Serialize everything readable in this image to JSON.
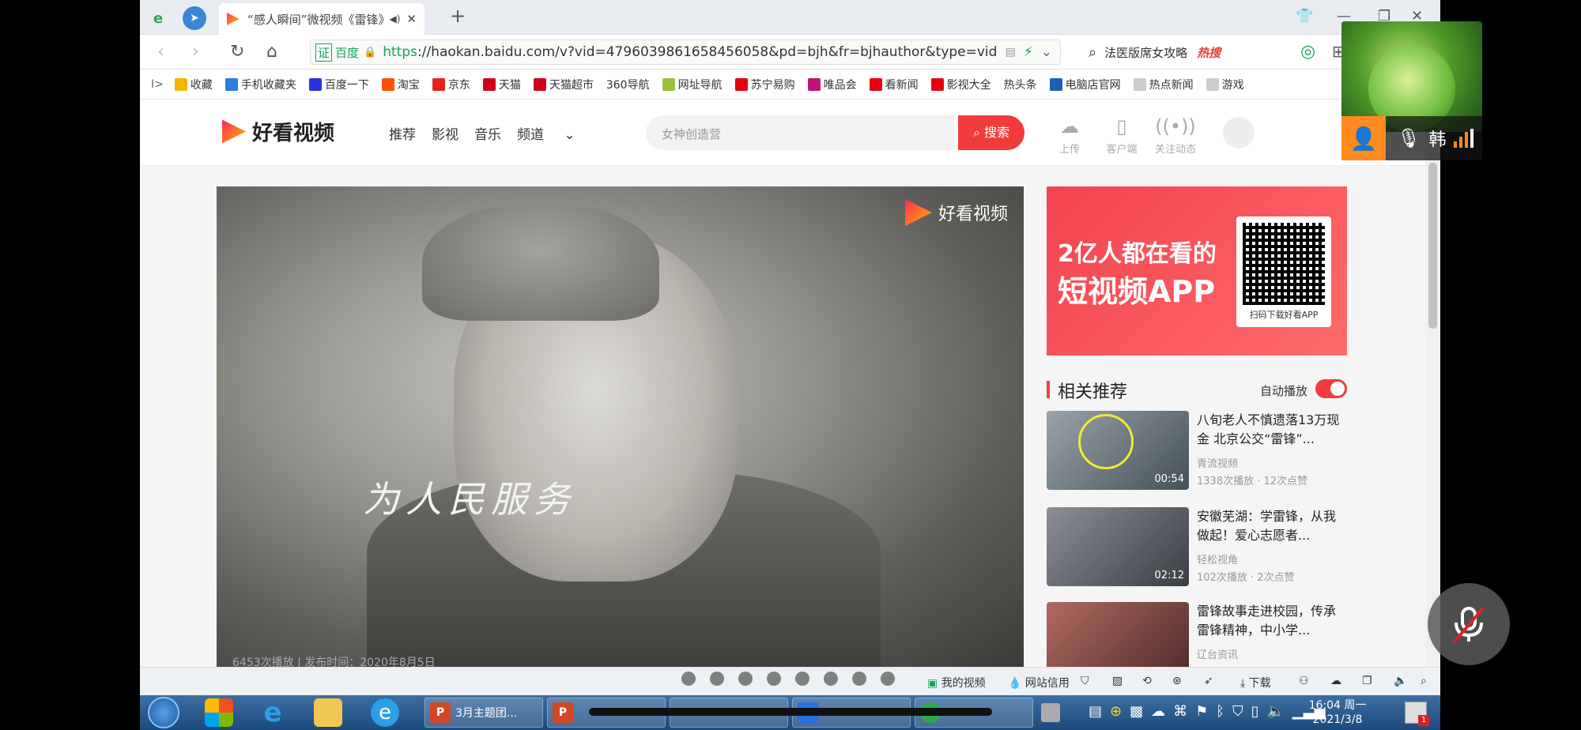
{
  "browser": {
    "tab_title": "“感人瞬间”微视频《雷锋》",
    "url_prefix": "https",
    "url_rest": "://haokan.baidu.com/v?vid=4796039861658456058&pd=bjh&fr=bjhauthor&type=video",
    "cert_label": "证",
    "site_badge": "百度",
    "search_text": "法医版席女攻略",
    "hot_label": "热搜"
  },
  "bookmarks": [
    {
      "label": "收藏",
      "color": "#f4b400",
      "icon": "star-icon"
    },
    {
      "label": "手机收藏夹",
      "color": "#2a7de1",
      "icon": "phone-icon"
    },
    {
      "label": "百度一下",
      "color": "#2932e1",
      "icon": "paw-icon"
    },
    {
      "label": "淘宝",
      "color": "#ff5000",
      "icon": "taobao-icon"
    },
    {
      "label": "京东",
      "color": "#e1251b",
      "icon": "jd-icon"
    },
    {
      "label": "天猫",
      "color": "#d0021b",
      "icon": "tmall-icon"
    },
    {
      "label": "天猫超市",
      "color": "#d0021b",
      "icon": "tmall-icon"
    },
    {
      "label": "360导航",
      "color": "#ffffff",
      "icon": ""
    },
    {
      "label": "网址导航",
      "color": "#9bc23c",
      "icon": "nav-icon"
    },
    {
      "label": "苏宁易购",
      "color": "#e60012",
      "icon": "suning-icon"
    },
    {
      "label": "唯品会",
      "color": "#c2127a",
      "icon": "vip-icon"
    },
    {
      "label": "看新闻",
      "color": "#e60012",
      "icon": "news-icon"
    },
    {
      "label": "影视大全",
      "color": "#e60012",
      "icon": "video-icon"
    },
    {
      "label": "热头条",
      "color": "#ffffff",
      "icon": ""
    },
    {
      "label": "电脑店官网",
      "color": "#1d5fb4",
      "icon": "pc-icon"
    },
    {
      "label": "热点新闻",
      "color": "#cccccc",
      "icon": "doc-icon"
    },
    {
      "label": "游戏",
      "color": "#cccccc",
      "icon": "doc-icon"
    }
  ],
  "site": {
    "logo": "好看视频",
    "nav": [
      "推荐",
      "影视",
      "音乐",
      "频道"
    ],
    "search_placeholder": "女神创造营",
    "search_button": "搜索",
    "header_icons": [
      {
        "label": "上传",
        "icon": "upload-icon"
      },
      {
        "label": "客户端",
        "icon": "client-icon"
      },
      {
        "label": "关注动态",
        "icon": "feed-icon"
      }
    ]
  },
  "video": {
    "watermark": "好看视频",
    "calligraphy": "为人民服务",
    "stats": "6453次播放 | 发布时间：2020年8月5日"
  },
  "ad": {
    "line1": "2亿人都在看的",
    "line2": "短视频APP",
    "qr_label": "扫码下载好看APP"
  },
  "recommend": {
    "title": "相关推荐",
    "autoplay_label": "自动播放",
    "autoplay_on": true,
    "items": [
      {
        "title": "八旬老人不慎遗落13万现金 北京公交“雷锋”...",
        "source": "青流视频",
        "meta": "1338次播放 · 12次点赞",
        "duration": "00:54"
      },
      {
        "title": "安徽芜湖：学雷锋，从我做起！爱心志愿者...",
        "source": "轻松视角",
        "meta": "102次播放 · 2次点赞",
        "duration": "02:12"
      },
      {
        "title": "雷锋故事走进校园，传承雷锋精神，中小学...",
        "source": "辽台资讯",
        "meta": "",
        "duration": ""
      }
    ]
  },
  "statusbar": {
    "my_video": "我的视频",
    "trust": "网站信用",
    "download": "下载"
  },
  "taskbar": {
    "apps": [
      "3月主题团..."
    ],
    "time": "16:04 周一",
    "date": "2021/3/8"
  },
  "pip": {
    "name": "韩"
  },
  "media_progress": 0.0
}
